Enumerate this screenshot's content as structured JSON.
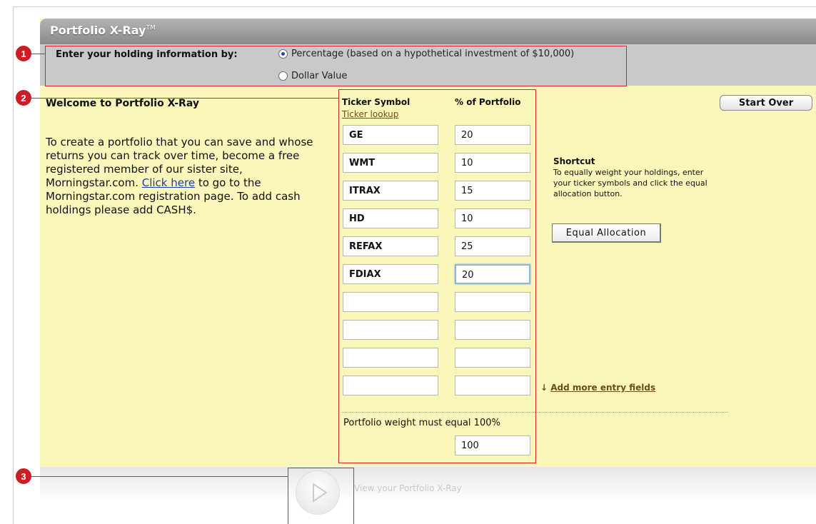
{
  "app": {
    "title": "Portfolio X-Ray",
    "title_mark": "TM"
  },
  "entry": {
    "label": "Enter your holding information by:",
    "option_percentage": "Percentage (based on a hypothetical investment of $10,000)",
    "option_dollar": "Dollar Value",
    "selected": "percentage"
  },
  "welcome": {
    "title": "Welcome to Portfolio X-Ray",
    "text_before_link": "To create a portfolio that you can save and whose returns you can track over time, become a free registered member of our sister site, Morningstar.com. ",
    "link": "Click here",
    "text_after_link": " to go to the Morningstar.com registration page. To add cash holdings please add CASH$."
  },
  "holdings": {
    "ticker_header": "Ticker Symbol",
    "pct_header": "% of Portfolio",
    "ticker_lookup": "Ticker lookup",
    "rows": [
      {
        "ticker": "GE",
        "pct": "20"
      },
      {
        "ticker": "WMT",
        "pct": "10"
      },
      {
        "ticker": "ITRAX",
        "pct": "15"
      },
      {
        "ticker": "HD",
        "pct": "10"
      },
      {
        "ticker": "REFAX",
        "pct": "25"
      },
      {
        "ticker": "FDIAX",
        "pct": "20"
      },
      {
        "ticker": "",
        "pct": ""
      },
      {
        "ticker": "",
        "pct": ""
      },
      {
        "ticker": "",
        "pct": ""
      },
      {
        "ticker": "",
        "pct": ""
      }
    ],
    "add_more": "Add more entry fields",
    "weight_note": "Portfolio weight must equal 100%",
    "total": "100"
  },
  "buttons": {
    "start_over": "Start Over",
    "equal_allocation": "Equal Allocation"
  },
  "shortcut": {
    "title": "Shortcut",
    "text": "To equally weight your holdings, enter your ticker symbols and click the equal allocation button."
  },
  "footer": {
    "view_label": "View your Portfolio X-Ray"
  },
  "callouts": [
    "1",
    "2",
    "3"
  ],
  "colors": {
    "panel": "#fbf6b9",
    "callout": "#d9232e",
    "titlebar": "#9a9a9a"
  }
}
